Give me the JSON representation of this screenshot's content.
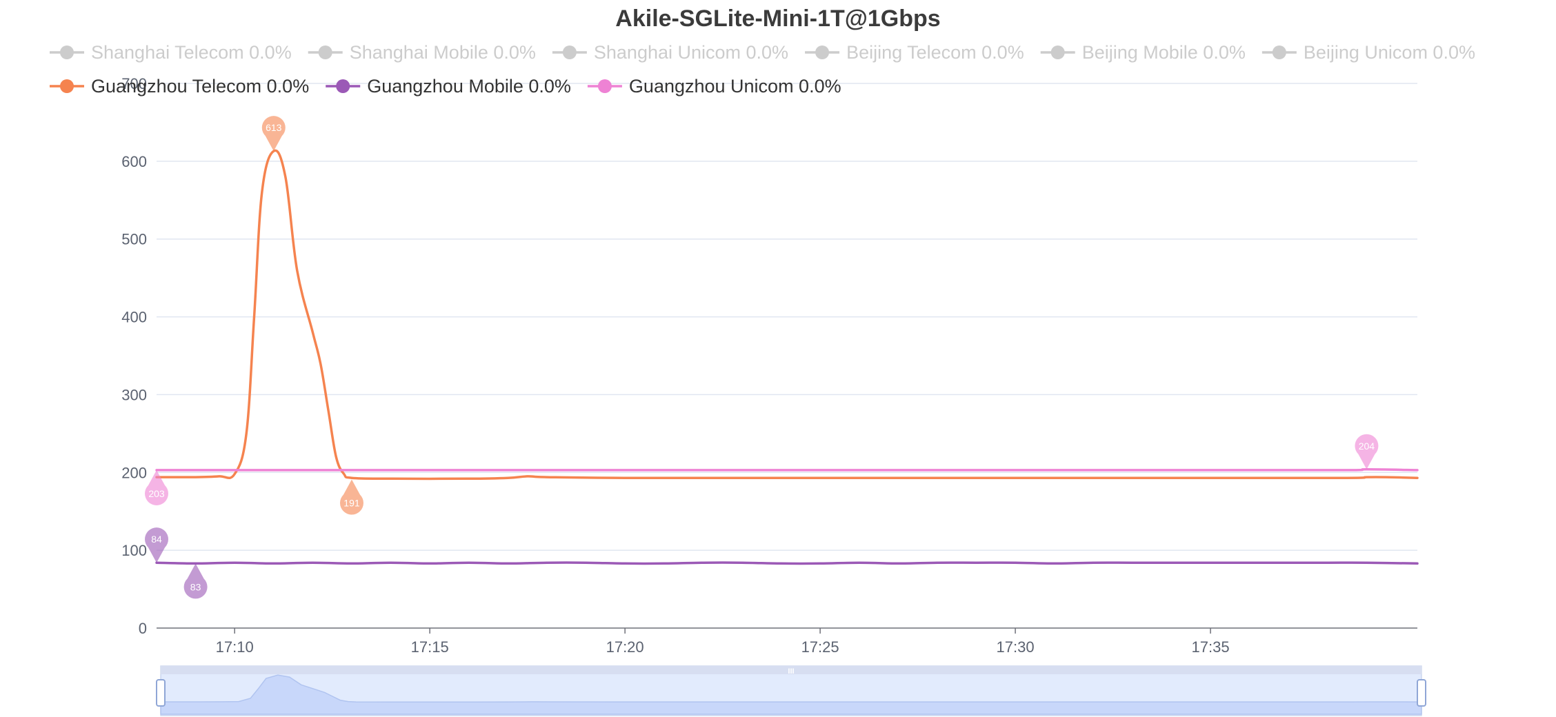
{
  "chart_data": {
    "type": "line",
    "title": "Akile-SGLite-Mini-1T@1Gbps",
    "xlabel": "",
    "ylabel": "",
    "ylim": [
      0,
      700
    ],
    "yticks": [
      "0",
      "100",
      "200",
      "300",
      "400",
      "500",
      "600",
      "700"
    ],
    "xlim_minutes": [
      548,
      580.3
    ],
    "xticks": [
      {
        "label": "17:10",
        "minute": 550
      },
      {
        "label": "17:15",
        "minute": 555
      },
      {
        "label": "17:20",
        "minute": 560
      },
      {
        "label": "17:25",
        "minute": 565
      },
      {
        "label": "17:30",
        "minute": 570
      },
      {
        "label": "17:35",
        "minute": 575
      }
    ],
    "grid": true,
    "legend_position": "top",
    "legend": [
      {
        "name": "Shanghai Telecom 0.0%",
        "active": false
      },
      {
        "name": "Shanghai Mobile 0.0%",
        "active": false
      },
      {
        "name": "Shanghai Unicom 0.0%",
        "active": false
      },
      {
        "name": "Beijing Telecom 0.0%",
        "active": false
      },
      {
        "name": "Beijing Mobile 0.0%",
        "active": false
      },
      {
        "name": "Beijing Unicom 0.0%",
        "active": false
      },
      {
        "name": "Guangzhou Telecom 0.0%",
        "active": true,
        "color": "#f5834f"
      },
      {
        "name": "Guangzhou Mobile 0.0%",
        "active": true,
        "color": "#9b59b6"
      },
      {
        "name": "Guangzhou Unicom 0.0%",
        "active": true,
        "color": "#ee82d4"
      }
    ],
    "series": [
      {
        "name": "Guangzhou Telecom 0.0%",
        "color": "#f5834f",
        "points": [
          [
            548,
            194
          ],
          [
            549,
            194
          ],
          [
            549.6,
            195
          ],
          [
            550,
            198
          ],
          [
            550.3,
            250
          ],
          [
            550.5,
            400
          ],
          [
            550.7,
            560
          ],
          [
            551,
            613
          ],
          [
            551.3,
            580
          ],
          [
            551.6,
            460
          ],
          [
            552,
            380
          ],
          [
            552.2,
            340
          ],
          [
            552.4,
            280
          ],
          [
            552.6,
            220
          ],
          [
            552.8,
            198
          ],
          [
            553,
            193
          ],
          [
            554,
            192
          ],
          [
            556,
            192
          ],
          [
            557,
            193
          ],
          [
            557.5,
            195
          ],
          [
            558,
            194
          ],
          [
            560,
            193
          ],
          [
            565,
            193
          ],
          [
            570,
            193
          ],
          [
            575,
            193
          ],
          [
            578.5,
            193
          ],
          [
            579,
            194
          ],
          [
            579.5,
            194
          ],
          [
            580.3,
            193
          ]
        ],
        "markers": [
          {
            "x": 551,
            "y": 613,
            "label": "613",
            "kind": "max"
          },
          {
            "x": 553,
            "y": 191,
            "label": "191",
            "kind": "min"
          }
        ]
      },
      {
        "name": "Guangzhou Mobile 0.0%",
        "color": "#9b59b6",
        "points": [
          [
            548,
            84
          ],
          [
            549,
            83
          ],
          [
            550,
            84
          ],
          [
            551,
            83
          ],
          [
            552,
            84
          ],
          [
            553,
            83
          ],
          [
            554,
            84
          ],
          [
            555,
            83
          ],
          [
            556,
            84
          ],
          [
            557,
            83
          ],
          [
            558,
            84
          ],
          [
            559,
            84
          ],
          [
            560,
            83
          ],
          [
            561,
            83
          ],
          [
            562,
            84
          ],
          [
            563,
            84
          ],
          [
            564,
            83
          ],
          [
            565,
            83
          ],
          [
            566,
            84
          ],
          [
            567,
            83
          ],
          [
            568,
            84
          ],
          [
            569,
            84
          ],
          [
            570,
            84
          ],
          [
            571,
            83
          ],
          [
            572,
            84
          ],
          [
            573,
            84
          ],
          [
            574,
            84
          ],
          [
            575,
            84
          ],
          [
            576,
            84
          ],
          [
            577,
            84
          ],
          [
            578,
            84
          ],
          [
            579,
            84
          ],
          [
            580.3,
            83
          ]
        ],
        "markers": [
          {
            "x": 548,
            "y": 84,
            "label": "84",
            "kind": "max"
          },
          {
            "x": 549,
            "y": 83,
            "label": "83",
            "kind": "min"
          }
        ]
      },
      {
        "name": "Guangzhou Unicom 0.0%",
        "color": "#ee82d4",
        "points": [
          [
            548,
            203
          ],
          [
            555,
            203
          ],
          [
            560,
            203
          ],
          [
            565,
            203
          ],
          [
            570,
            203
          ],
          [
            575,
            203
          ],
          [
            578.5,
            203
          ],
          [
            579,
            204
          ],
          [
            580.3,
            203
          ]
        ],
        "markers": [
          {
            "x": 548,
            "y": 203,
            "label": "203",
            "kind": "min"
          },
          {
            "x": 579,
            "y": 204,
            "label": "204",
            "kind": "max"
          }
        ]
      }
    ],
    "data_zoom": {
      "start_percent": 0,
      "end_percent": 100,
      "handle_label": "III"
    }
  }
}
